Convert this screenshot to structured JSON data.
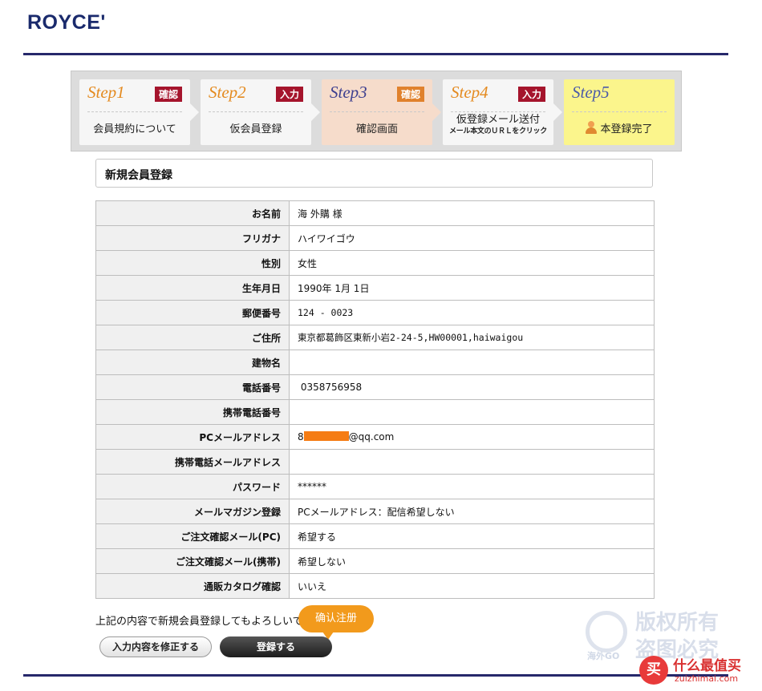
{
  "header": {
    "logo": "ROYCE'"
  },
  "steps": [
    {
      "name": "Step1",
      "badge": "確認",
      "label": "会員規約について"
    },
    {
      "name": "Step2",
      "badge": "入力",
      "label": "仮会員登録"
    },
    {
      "name": "Step3",
      "badge": "確認",
      "label": "確認画面",
      "active": true
    },
    {
      "name": "Step4",
      "badge": "入力",
      "label": "仮登録メール送付",
      "sublabel": "メール本文のＵＲＬをクリック"
    },
    {
      "name": "Step5",
      "label": "本登録完了",
      "icon": "person-icon"
    }
  ],
  "section": {
    "title": "新規会員登録"
  },
  "form": {
    "rows": [
      {
        "label": "お名前",
        "value": "海 外購 様"
      },
      {
        "label": "フリガナ",
        "value": "ハイワイゴウ"
      },
      {
        "label": "性別",
        "value": "女性"
      },
      {
        "label": "生年月日",
        "value": "1990年 1月 1日"
      },
      {
        "label": "郵便番号",
        "value": "124 - 0023"
      },
      {
        "label": "ご住所",
        "value": "東京都葛飾区東新小岩2-24-5,HW00001,haiwaigou"
      },
      {
        "label": "建物名",
        "value": ""
      },
      {
        "label": "電話番号",
        "value": " 0358756958"
      },
      {
        "label": "携帯電話番号",
        "value": ""
      },
      {
        "label": "PCメールアドレス",
        "value_prefix": "8",
        "value_suffix": "@qq.com"
      },
      {
        "label": "携帯電話メールアドレス",
        "value": ""
      },
      {
        "label": "パスワード",
        "value": "******"
      },
      {
        "label": "メールマガジン登録",
        "value": "PCメールアドレス：配信希望しない"
      },
      {
        "label": "ご注文確認メール(PC)",
        "value": "希望する"
      },
      {
        "label": "ご注文確認メール(携帯)",
        "value": "希望しない"
      },
      {
        "label": "通販カタログ確認",
        "value": "いいえ"
      }
    ]
  },
  "confirm": {
    "text": "上記の内容で新規会員登録してもよろしいです",
    "tooltip": "确认注册",
    "edit_button": "入力内容を修正する",
    "submit_button": "登録する"
  },
  "watermarks": {
    "copyright_line1": "版权所有",
    "copyright_line2": "盗图必究",
    "copyright_logo": "海外GO",
    "site_name": "什么最值买",
    "site_url": "zuizhimai.com",
    "site_icon": "买"
  },
  "colors": {
    "brand_navy": "#26286b",
    "step_orange": "#e48a1f",
    "badge_red": "#a5142c",
    "active_step_bg": "#f6dccb",
    "final_step_bg": "#fbf58c",
    "tooltip_orange": "#f29a1c",
    "redaction": "#f57c14"
  }
}
